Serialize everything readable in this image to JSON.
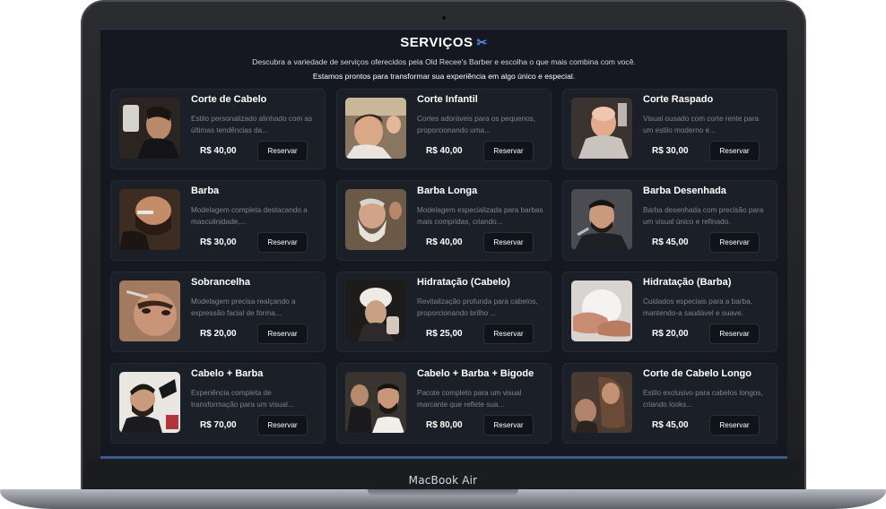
{
  "device": {
    "label": "MacBook Air"
  },
  "header": {
    "title": "SERVIÇOS",
    "title_icon": "scissors-icon",
    "subtitle_1": "Descubra a variedade de serviços oferecidos pela Old Recee's Barber e escolha o que mais combina com você.",
    "subtitle_2": "Estamos prontos para transformar sua experiência em algo único e especial."
  },
  "services": [
    {
      "title": "Corte de Cabelo",
      "description": "Estilo personalizado alinhado com as últimas tendências da...",
      "price": "R$ 40,00",
      "button": "Reservar"
    },
    {
      "title": "Corte Infantil",
      "description": "Cortes adoráveis para os pequenos, proporcionando uma...",
      "price": "R$ 40,00",
      "button": "Reservar"
    },
    {
      "title": "Corte Raspado",
      "description": "Visual ousado com corte rente para um estilo moderno e...",
      "price": "R$ 30,00",
      "button": "Reservar"
    },
    {
      "title": "Barba",
      "description": "Modelagem completa destacando a masculinidade,...",
      "price": "R$ 30,00",
      "button": "Reservar"
    },
    {
      "title": "Barba Longa",
      "description": "Modelagem especializada para barbas mais compridas, criando...",
      "price": "R$ 40,00",
      "button": "Reservar"
    },
    {
      "title": "Barba Desenhada",
      "description": "Barba desenhada com precisão para um visual único e refinado.",
      "price": "R$ 45,00",
      "button": "Reservar"
    },
    {
      "title": "Sobrancelha",
      "description": "Modelagem precisa realçando a expressão facial de forma...",
      "price": "R$ 20,00",
      "button": "Reservar"
    },
    {
      "title": "Hidratação (Cabelo)",
      "description": "Revitalização profunda para cabelos, proporcionando brilho ...",
      "price": "R$ 25,00",
      "button": "Reservar"
    },
    {
      "title": "Hidratação (Barba)",
      "description": "Cuidados especiais para a barba, mantendo-a saudável e suave.",
      "price": "R$ 20,00",
      "button": "Reservar"
    },
    {
      "title": "Cabelo + Barba",
      "description": "Experiência completa de transformação para um visual...",
      "price": "R$ 70,00",
      "button": "Reservar"
    },
    {
      "title": "Cabelo + Barba + Bigode",
      "description": "Pacote completo para um visual marcante que reflete sua...",
      "price": "R$ 80,00",
      "button": "Reservar"
    },
    {
      "title": "Corte de Cabelo Longo",
      "description": "Estilo exclusivo para cabelos longos, criando looks...",
      "price": "R$ 45,00",
      "button": "Reservar"
    }
  ],
  "colors": {
    "screen_bg": "#151821",
    "card_bg": "#1b1f28",
    "accent": "#4f8bd8",
    "muted_text": "#7d8496"
  }
}
